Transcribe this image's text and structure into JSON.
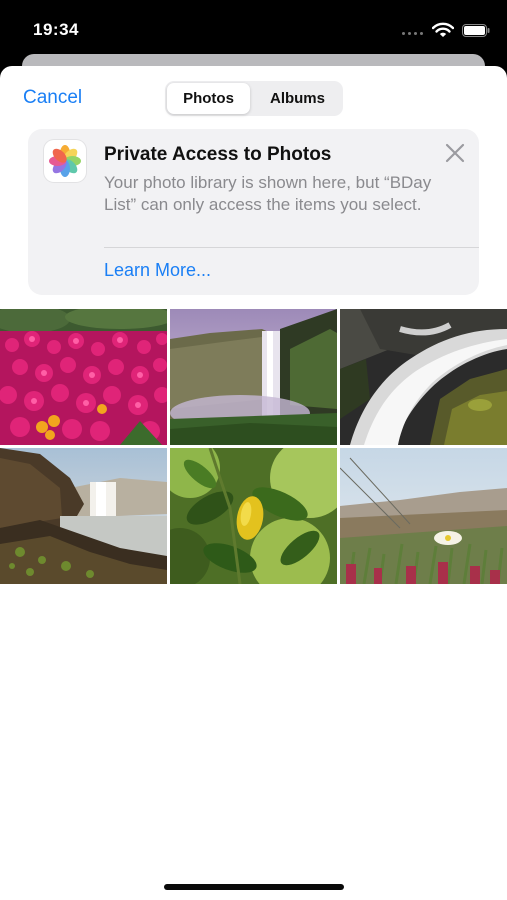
{
  "status_bar": {
    "time": "19:34",
    "icons": [
      "wifi-icon",
      "battery-icon"
    ]
  },
  "nav": {
    "cancel_label": "Cancel",
    "tabs": [
      {
        "label": "Photos",
        "selected": true
      },
      {
        "label": "Albums",
        "selected": false
      }
    ]
  },
  "banner": {
    "icon": "photos-app-icon",
    "title": "Private Access to Photos",
    "body": "Your photo library is shown here, but “BDay List” can only access the items you select.",
    "link_label": "Learn More...",
    "close_icon": "close-icon"
  },
  "photos": [
    {
      "subject": "flowers"
    },
    {
      "subject": "waterfall-cliff"
    },
    {
      "subject": "water-rocks"
    },
    {
      "subject": "waterfall-coast"
    },
    {
      "subject": "lemon-leaves"
    },
    {
      "subject": "white-flower-grass"
    }
  ],
  "colors": {
    "accent": "#1a7ff5",
    "banner_bg": "#f2f2f4",
    "secondary_text": "#8a8a8e"
  }
}
